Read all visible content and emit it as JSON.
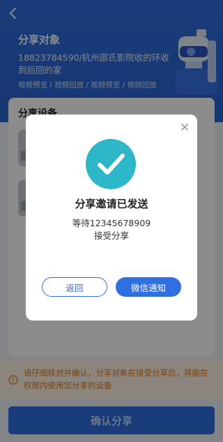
{
  "header": {
    "title": "分享对象",
    "description": "18823784590/杭州邵氏影院收的环收到后回的家",
    "permissions": "视频预览 / 视频回放 / 视频预览 / 视频回放"
  },
  "devices": {
    "section_title": "分享设备"
  },
  "notice": {
    "text": "请仔细核对并确认，分享对象在接受分享后，将能在权限内使用您分享的设备"
  },
  "confirm_button": "确认分享",
  "modal": {
    "title": "分享邀请已发送",
    "line1": "等待12345678909",
    "line2": "接受分享",
    "return_label": "返回",
    "wechat_label": "微信通知"
  },
  "colors": {
    "primary": "#2f6fe0",
    "success": "#2eb7c9",
    "warning": "#e07a1d"
  }
}
